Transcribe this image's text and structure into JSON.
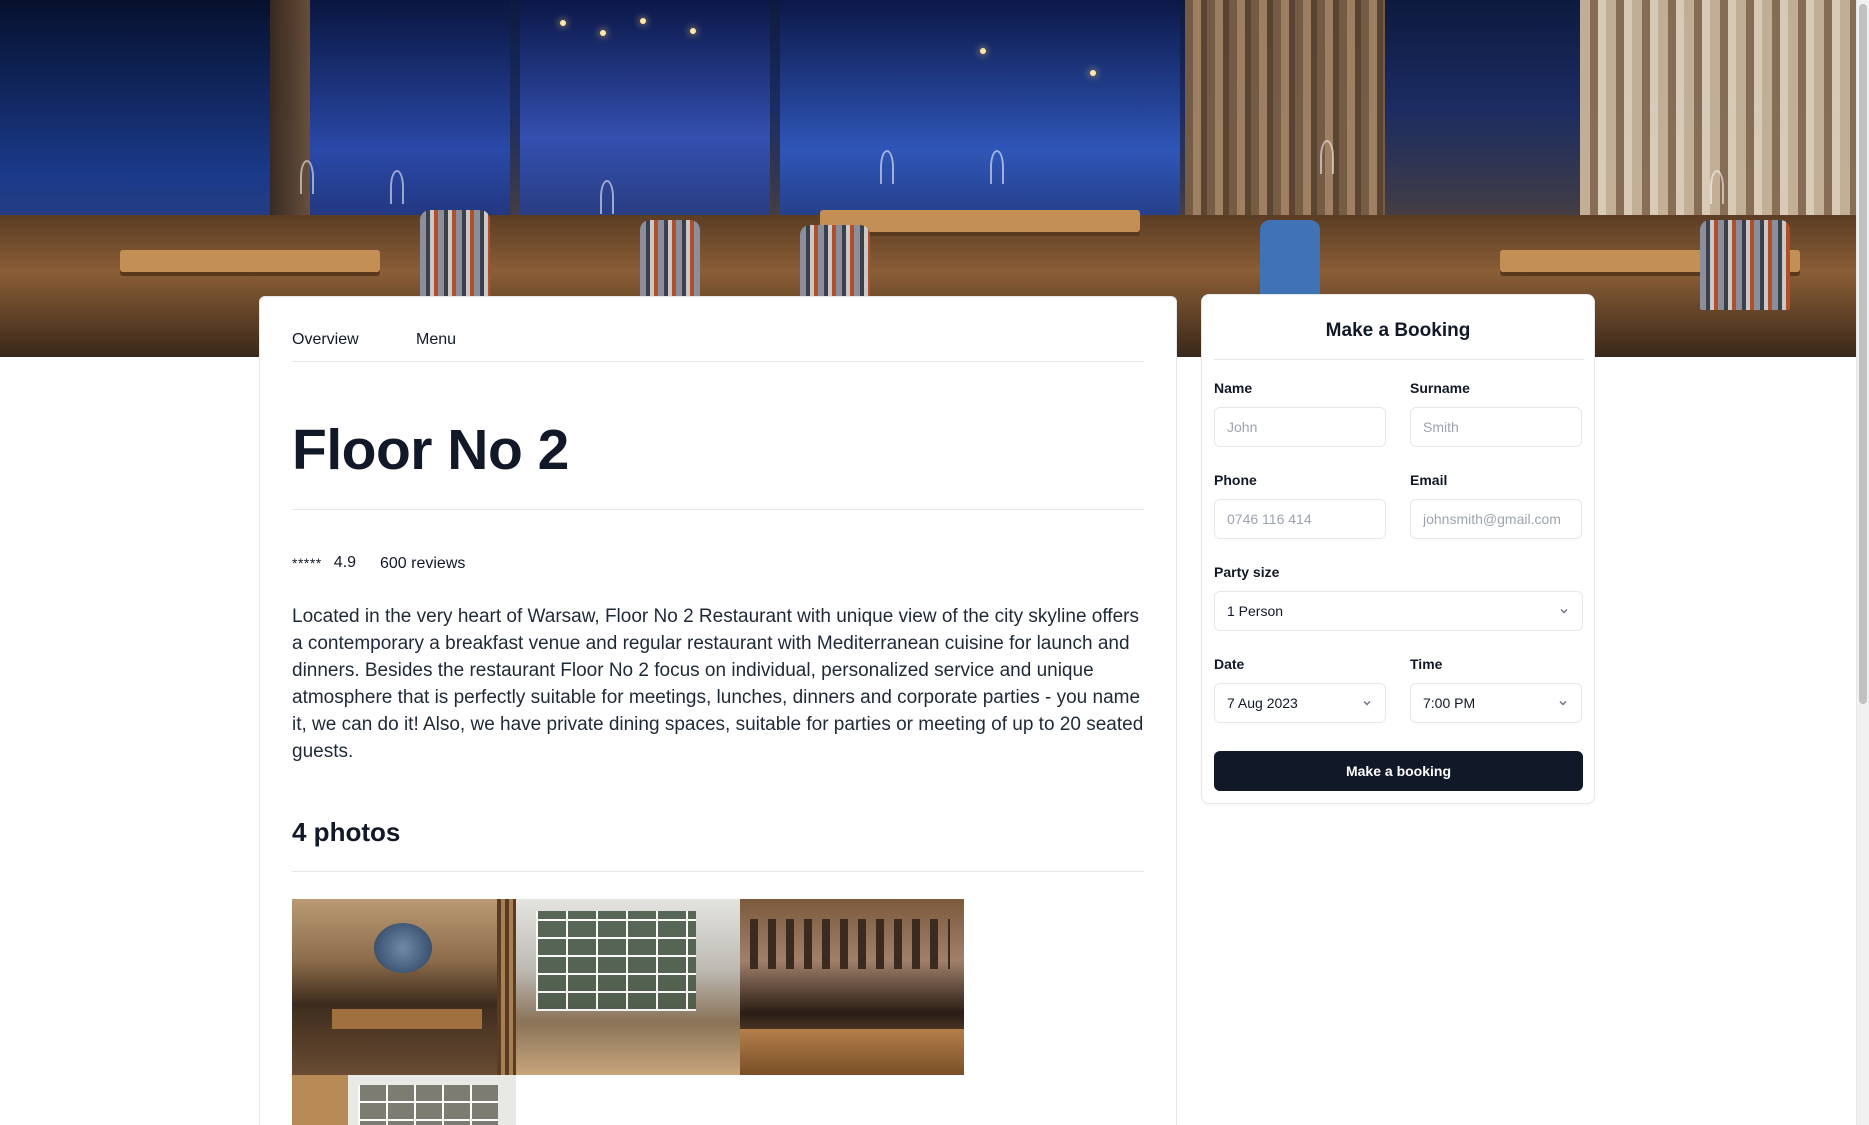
{
  "tabs": {
    "overview": "Overview",
    "menu": "Menu"
  },
  "restaurant": {
    "name": "Floor No 2",
    "stars": "*****",
    "rating": "4.9",
    "reviews": "600 reviews",
    "description": "Located in the very heart of Warsaw, Floor No 2 Restaurant with unique view of the city skyline offers a contemporary a breakfast venue and regular restaurant with Mediterranean cuisine for launch and dinners. Besides the restaurant Floor No 2 focus on individual, personalized service and unique atmosphere that is perfectly suitable for meetings, lunches, dinners and corporate parties - you name it, we can do it! Also, we have private dining spaces, suitable for parties or meeting of up to 20 seated guests."
  },
  "photos": {
    "title": "4 photos"
  },
  "booking": {
    "title": "Make a Booking",
    "name_label": "Name",
    "name_placeholder": "John",
    "surname_label": "Surname",
    "surname_placeholder": "Smith",
    "phone_label": "Phone",
    "phone_placeholder": "0746 116 414",
    "email_label": "Email",
    "email_placeholder": "johnsmith@gmail.com",
    "party_label": "Party size",
    "party_value": "1 Person",
    "date_label": "Date",
    "date_value": "7 Aug 2023",
    "time_label": "Time",
    "time_value": "7:00 PM",
    "submit_label": "Make a booking"
  },
  "colors": {
    "button_bg": "#111827",
    "border": "#e5e7eb",
    "text": "#111827"
  },
  "icons": {
    "select_chevron": "chevron-down-icon"
  }
}
